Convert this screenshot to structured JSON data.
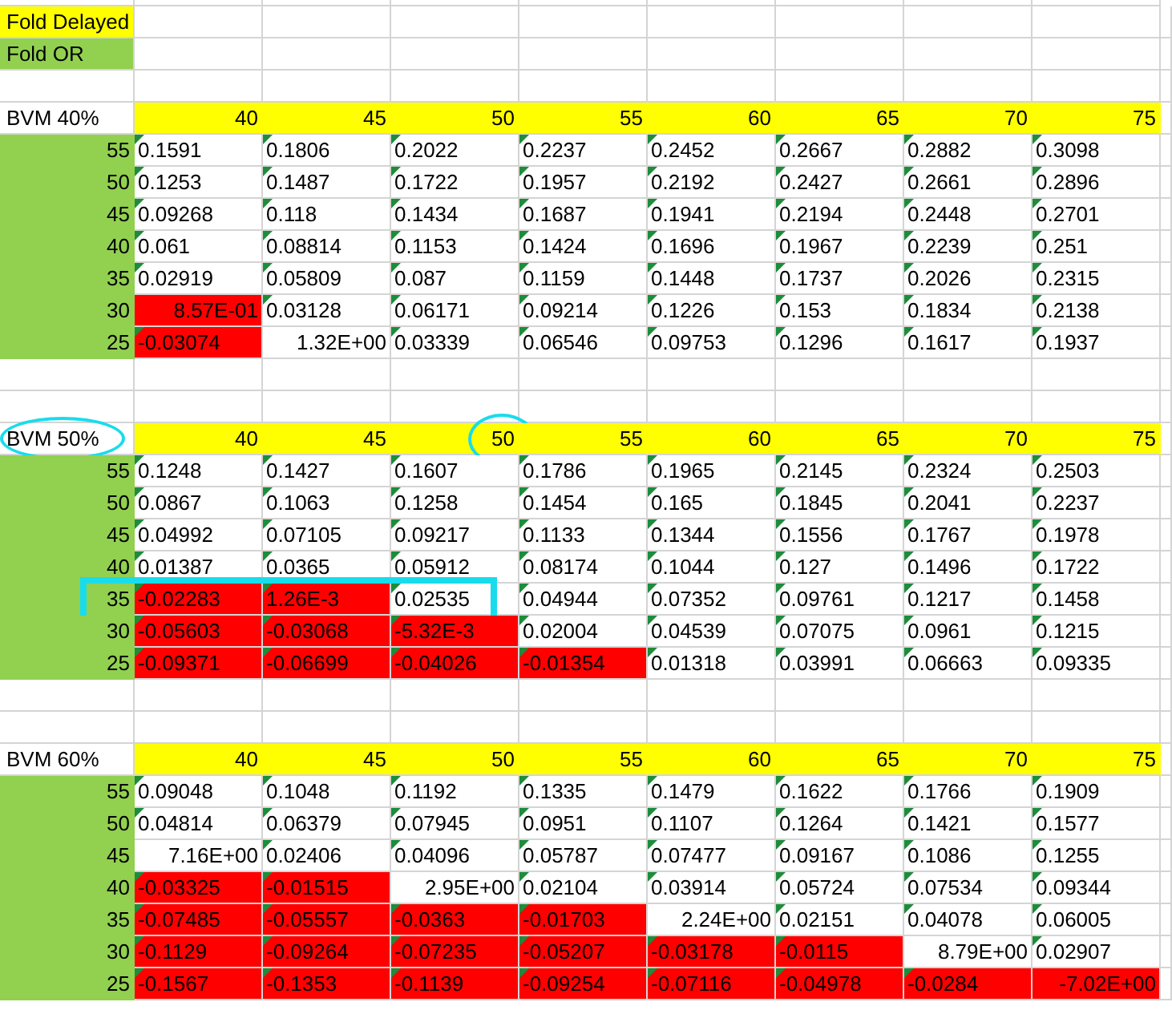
{
  "legend": [
    {
      "label": "Fold Delayed",
      "color": "#ffff00"
    },
    {
      "label": "Fold OR",
      "color": "#92d050"
    }
  ],
  "tables": [
    {
      "label": "BVM 40%",
      "circled": false,
      "columns": [
        {
          "label": "40",
          "circled": false
        },
        {
          "label": "45",
          "circled": false
        },
        {
          "label": "50",
          "circled": false
        },
        {
          "label": "55",
          "circled": false
        },
        {
          "label": "60",
          "circled": false
        },
        {
          "label": "65",
          "circled": false
        },
        {
          "label": "70",
          "circled": false
        },
        {
          "label": "75",
          "circled": false
        }
      ],
      "rows": [
        {
          "label": "55",
          "boxed": false,
          "cells": [
            {
              "value": "0.1591",
              "kind": "text",
              "red": false
            },
            {
              "value": "0.1806",
              "kind": "text",
              "red": false
            },
            {
              "value": "0.2022",
              "kind": "text",
              "red": false
            },
            {
              "value": "0.2237",
              "kind": "text",
              "red": false
            },
            {
              "value": "0.2452",
              "kind": "text",
              "red": false
            },
            {
              "value": "0.2667",
              "kind": "text",
              "red": false
            },
            {
              "value": "0.2882",
              "kind": "text",
              "red": false
            },
            {
              "value": "0.3098",
              "kind": "text",
              "red": false
            }
          ]
        },
        {
          "label": "50",
          "boxed": false,
          "cells": [
            {
              "value": "0.1253",
              "kind": "text",
              "red": false
            },
            {
              "value": "0.1487",
              "kind": "text",
              "red": false
            },
            {
              "value": "0.1722",
              "kind": "text",
              "red": false
            },
            {
              "value": "0.1957",
              "kind": "text",
              "red": false
            },
            {
              "value": "0.2192",
              "kind": "text",
              "red": false
            },
            {
              "value": "0.2427",
              "kind": "text",
              "red": false
            },
            {
              "value": "0.2661",
              "kind": "text",
              "red": false
            },
            {
              "value": "0.2896",
              "kind": "text",
              "red": false
            }
          ]
        },
        {
          "label": "45",
          "boxed": false,
          "cells": [
            {
              "value": "0.09268",
              "kind": "text",
              "red": false
            },
            {
              "value": "0.118",
              "kind": "text",
              "red": false
            },
            {
              "value": "0.1434",
              "kind": "text",
              "red": false
            },
            {
              "value": "0.1687",
              "kind": "text",
              "red": false
            },
            {
              "value": "0.1941",
              "kind": "text",
              "red": false
            },
            {
              "value": "0.2194",
              "kind": "text",
              "red": false
            },
            {
              "value": "0.2448",
              "kind": "text",
              "red": false
            },
            {
              "value": "0.2701",
              "kind": "text",
              "red": false
            }
          ]
        },
        {
          "label": "40",
          "boxed": false,
          "cells": [
            {
              "value": "0.061",
              "kind": "text",
              "red": false
            },
            {
              "value": "0.08814",
              "kind": "text",
              "red": false
            },
            {
              "value": "0.1153",
              "kind": "text",
              "red": false
            },
            {
              "value": "0.1424",
              "kind": "text",
              "red": false
            },
            {
              "value": "0.1696",
              "kind": "text",
              "red": false
            },
            {
              "value": "0.1967",
              "kind": "text",
              "red": false
            },
            {
              "value": "0.2239",
              "kind": "text",
              "red": false
            },
            {
              "value": "0.251",
              "kind": "text",
              "red": false
            }
          ]
        },
        {
          "label": "35",
          "boxed": false,
          "cells": [
            {
              "value": "0.02919",
              "kind": "text",
              "red": false
            },
            {
              "value": "0.05809",
              "kind": "text",
              "red": false
            },
            {
              "value": "0.087",
              "kind": "text",
              "red": false
            },
            {
              "value": "0.1159",
              "kind": "text",
              "red": false
            },
            {
              "value": "0.1448",
              "kind": "text",
              "red": false
            },
            {
              "value": "0.1737",
              "kind": "text",
              "red": false
            },
            {
              "value": "0.2026",
              "kind": "text",
              "red": false
            },
            {
              "value": "0.2315",
              "kind": "text",
              "red": false
            }
          ]
        },
        {
          "label": "30",
          "boxed": false,
          "cells": [
            {
              "value": "8.57E-01",
              "kind": "number",
              "red": true
            },
            {
              "value": "0.03128",
              "kind": "text",
              "red": false
            },
            {
              "value": "0.06171",
              "kind": "text",
              "red": false
            },
            {
              "value": "0.09214",
              "kind": "text",
              "red": false
            },
            {
              "value": "0.1226",
              "kind": "text",
              "red": false
            },
            {
              "value": "0.153",
              "kind": "text",
              "red": false
            },
            {
              "value": "0.1834",
              "kind": "text",
              "red": false
            },
            {
              "value": "0.2138",
              "kind": "text",
              "red": false
            }
          ]
        },
        {
          "label": "25",
          "boxed": false,
          "cells": [
            {
              "value": "-0.03074",
              "kind": "text",
              "red": true
            },
            {
              "value": "1.32E+00",
              "kind": "number",
              "red": false
            },
            {
              "value": "0.03339",
              "kind": "text",
              "red": false
            },
            {
              "value": "0.06546",
              "kind": "text",
              "red": false
            },
            {
              "value": "0.09753",
              "kind": "text",
              "red": false
            },
            {
              "value": "0.1296",
              "kind": "text",
              "red": false
            },
            {
              "value": "0.1617",
              "kind": "text",
              "red": false
            },
            {
              "value": "0.1937",
              "kind": "text",
              "red": false
            }
          ]
        }
      ]
    },
    {
      "label": "BVM 50%",
      "circled": true,
      "columns": [
        {
          "label": "40",
          "circled": false
        },
        {
          "label": "45",
          "circled": false
        },
        {
          "label": "50",
          "circled": true
        },
        {
          "label": "55",
          "circled": false
        },
        {
          "label": "60",
          "circled": false
        },
        {
          "label": "65",
          "circled": false
        },
        {
          "label": "70",
          "circled": false
        },
        {
          "label": "75",
          "circled": false
        }
      ],
      "rows": [
        {
          "label": "55",
          "boxed": false,
          "cells": [
            {
              "value": "0.1248",
              "kind": "text",
              "red": false
            },
            {
              "value": "0.1427",
              "kind": "text",
              "red": false
            },
            {
              "value": "0.1607",
              "kind": "text",
              "red": false
            },
            {
              "value": "0.1786",
              "kind": "text",
              "red": false
            },
            {
              "value": "0.1965",
              "kind": "text",
              "red": false
            },
            {
              "value": "0.2145",
              "kind": "text",
              "red": false
            },
            {
              "value": "0.2324",
              "kind": "text",
              "red": false
            },
            {
              "value": "0.2503",
              "kind": "text",
              "red": false
            }
          ]
        },
        {
          "label": "50",
          "boxed": false,
          "cells": [
            {
              "value": "0.0867",
              "kind": "text",
              "red": false
            },
            {
              "value": "0.1063",
              "kind": "text",
              "red": false
            },
            {
              "value": "0.1258",
              "kind": "text",
              "red": false
            },
            {
              "value": "0.1454",
              "kind": "text",
              "red": false
            },
            {
              "value": "0.165",
              "kind": "text",
              "red": false
            },
            {
              "value": "0.1845",
              "kind": "text",
              "red": false
            },
            {
              "value": "0.2041",
              "kind": "text",
              "red": false
            },
            {
              "value": "0.2237",
              "kind": "text",
              "red": false
            }
          ]
        },
        {
          "label": "45",
          "boxed": false,
          "cells": [
            {
              "value": "0.04992",
              "kind": "text",
              "red": false
            },
            {
              "value": "0.07105",
              "kind": "text",
              "red": false
            },
            {
              "value": "0.09217",
              "kind": "text",
              "red": false
            },
            {
              "value": "0.1133",
              "kind": "text",
              "red": false
            },
            {
              "value": "0.1344",
              "kind": "text",
              "red": false
            },
            {
              "value": "0.1556",
              "kind": "text",
              "red": false
            },
            {
              "value": "0.1767",
              "kind": "text",
              "red": false
            },
            {
              "value": "0.1978",
              "kind": "text",
              "red": false
            }
          ]
        },
        {
          "label": "40",
          "boxed": false,
          "cells": [
            {
              "value": "0.01387",
              "kind": "text",
              "red": false
            },
            {
              "value": "0.0365",
              "kind": "text",
              "red": false
            },
            {
              "value": "0.05912",
              "kind": "text",
              "red": false
            },
            {
              "value": "0.08174",
              "kind": "text",
              "red": false
            },
            {
              "value": "0.1044",
              "kind": "text",
              "red": false
            },
            {
              "value": "0.127",
              "kind": "text",
              "red": false
            },
            {
              "value": "0.1496",
              "kind": "text",
              "red": false
            },
            {
              "value": "0.1722",
              "kind": "text",
              "red": false
            }
          ]
        },
        {
          "label": "35",
          "boxed": true,
          "cells": [
            {
              "value": "-0.02283",
              "kind": "text",
              "red": true
            },
            {
              "value": "1.26E-3",
              "kind": "text",
              "red": true
            },
            {
              "value": "0.02535",
              "kind": "text",
              "red": false
            },
            {
              "value": "0.04944",
              "kind": "text",
              "red": false
            },
            {
              "value": "0.07352",
              "kind": "text",
              "red": false
            },
            {
              "value": "0.09761",
              "kind": "text",
              "red": false
            },
            {
              "value": "0.1217",
              "kind": "text",
              "red": false
            },
            {
              "value": "0.1458",
              "kind": "text",
              "red": false
            }
          ]
        },
        {
          "label": "30",
          "boxed": false,
          "cells": [
            {
              "value": "-0.05603",
              "kind": "text",
              "red": true
            },
            {
              "value": "-0.03068",
              "kind": "text",
              "red": true
            },
            {
              "value": "-5.32E-3",
              "kind": "text",
              "red": true
            },
            {
              "value": "0.02004",
              "kind": "text",
              "red": false
            },
            {
              "value": "0.04539",
              "kind": "text",
              "red": false
            },
            {
              "value": "0.07075",
              "kind": "text",
              "red": false
            },
            {
              "value": "0.0961",
              "kind": "text",
              "red": false
            },
            {
              "value": "0.1215",
              "kind": "text",
              "red": false
            }
          ]
        },
        {
          "label": "25",
          "boxed": false,
          "cells": [
            {
              "value": "-0.09371",
              "kind": "text",
              "red": true
            },
            {
              "value": "-0.06699",
              "kind": "text",
              "red": true
            },
            {
              "value": "-0.04026",
              "kind": "text",
              "red": true
            },
            {
              "value": "-0.01354",
              "kind": "text",
              "red": true
            },
            {
              "value": "0.01318",
              "kind": "text",
              "red": false
            },
            {
              "value": "0.03991",
              "kind": "text",
              "red": false
            },
            {
              "value": "0.06663",
              "kind": "text",
              "red": false
            },
            {
              "value": "0.09335",
              "kind": "text",
              "red": false
            }
          ]
        }
      ]
    },
    {
      "label": "BVM 60%",
      "circled": false,
      "columns": [
        {
          "label": "40",
          "circled": false
        },
        {
          "label": "45",
          "circled": false
        },
        {
          "label": "50",
          "circled": false
        },
        {
          "label": "55",
          "circled": false
        },
        {
          "label": "60",
          "circled": false
        },
        {
          "label": "65",
          "circled": false
        },
        {
          "label": "70",
          "circled": false
        },
        {
          "label": "75",
          "circled": false
        }
      ],
      "rows": [
        {
          "label": "55",
          "boxed": false,
          "cells": [
            {
              "value": "0.09048",
              "kind": "text",
              "red": false
            },
            {
              "value": "0.1048",
              "kind": "text",
              "red": false
            },
            {
              "value": "0.1192",
              "kind": "text",
              "red": false
            },
            {
              "value": "0.1335",
              "kind": "text",
              "red": false
            },
            {
              "value": "0.1479",
              "kind": "text",
              "red": false
            },
            {
              "value": "0.1622",
              "kind": "text",
              "red": false
            },
            {
              "value": "0.1766",
              "kind": "text",
              "red": false
            },
            {
              "value": "0.1909",
              "kind": "text",
              "red": false
            }
          ]
        },
        {
          "label": "50",
          "boxed": false,
          "cells": [
            {
              "value": "0.04814",
              "kind": "text",
              "red": false
            },
            {
              "value": "0.06379",
              "kind": "text",
              "red": false
            },
            {
              "value": "0.07945",
              "kind": "text",
              "red": false
            },
            {
              "value": "0.0951",
              "kind": "text",
              "red": false
            },
            {
              "value": "0.1107",
              "kind": "text",
              "red": false
            },
            {
              "value": "0.1264",
              "kind": "text",
              "red": false
            },
            {
              "value": "0.1421",
              "kind": "text",
              "red": false
            },
            {
              "value": "0.1577",
              "kind": "text",
              "red": false
            }
          ]
        },
        {
          "label": "45",
          "boxed": false,
          "cells": [
            {
              "value": "7.16E+00",
              "kind": "number",
              "red": false
            },
            {
              "value": "0.02406",
              "kind": "text",
              "red": false
            },
            {
              "value": "0.04096",
              "kind": "text",
              "red": false
            },
            {
              "value": "0.05787",
              "kind": "text",
              "red": false
            },
            {
              "value": "0.07477",
              "kind": "text",
              "red": false
            },
            {
              "value": "0.09167",
              "kind": "text",
              "red": false
            },
            {
              "value": "0.1086",
              "kind": "text",
              "red": false
            },
            {
              "value": "0.1255",
              "kind": "text",
              "red": false
            }
          ]
        },
        {
          "label": "40",
          "boxed": false,
          "cells": [
            {
              "value": "-0.03325",
              "kind": "text",
              "red": true
            },
            {
              "value": "-0.01515",
              "kind": "text",
              "red": true
            },
            {
              "value": "2.95E+00",
              "kind": "number",
              "red": false
            },
            {
              "value": "0.02104",
              "kind": "text",
              "red": false
            },
            {
              "value": "0.03914",
              "kind": "text",
              "red": false
            },
            {
              "value": "0.05724",
              "kind": "text",
              "red": false
            },
            {
              "value": "0.07534",
              "kind": "text",
              "red": false
            },
            {
              "value": "0.09344",
              "kind": "text",
              "red": false
            }
          ]
        },
        {
          "label": "35",
          "boxed": false,
          "cells": [
            {
              "value": "-0.07485",
              "kind": "text",
              "red": true
            },
            {
              "value": "-0.05557",
              "kind": "text",
              "red": true
            },
            {
              "value": "-0.0363",
              "kind": "text",
              "red": true
            },
            {
              "value": "-0.01703",
              "kind": "text",
              "red": true
            },
            {
              "value": "2.24E+00",
              "kind": "number",
              "red": false
            },
            {
              "value": "0.02151",
              "kind": "text",
              "red": false
            },
            {
              "value": "0.04078",
              "kind": "text",
              "red": false
            },
            {
              "value": "0.06005",
              "kind": "text",
              "red": false
            }
          ]
        },
        {
          "label": "30",
          "boxed": false,
          "cells": [
            {
              "value": "-0.1129",
              "kind": "text",
              "red": true
            },
            {
              "value": "-0.09264",
              "kind": "text",
              "red": true
            },
            {
              "value": "-0.07235",
              "kind": "text",
              "red": true
            },
            {
              "value": "-0.05207",
              "kind": "text",
              "red": true
            },
            {
              "value": "-0.03178",
              "kind": "text",
              "red": true
            },
            {
              "value": "-0.0115",
              "kind": "text",
              "red": true
            },
            {
              "value": "8.79E+00",
              "kind": "number",
              "red": false
            },
            {
              "value": "0.02907",
              "kind": "text",
              "red": false
            }
          ]
        },
        {
          "label": "25",
          "boxed": false,
          "cells": [
            {
              "value": "-0.1567",
              "kind": "text",
              "red": true
            },
            {
              "value": "-0.1353",
              "kind": "text",
              "red": true
            },
            {
              "value": "-0.1139",
              "kind": "text",
              "red": true
            },
            {
              "value": "-0.09254",
              "kind": "text",
              "red": true
            },
            {
              "value": "-0.07116",
              "kind": "text",
              "red": true
            },
            {
              "value": "-0.04978",
              "kind": "text",
              "red": true
            },
            {
              "value": "-0.0284",
              "kind": "text",
              "red": true
            },
            {
              "value": "-7.02E+00",
              "kind": "number",
              "red": true
            }
          ]
        }
      ]
    }
  ]
}
